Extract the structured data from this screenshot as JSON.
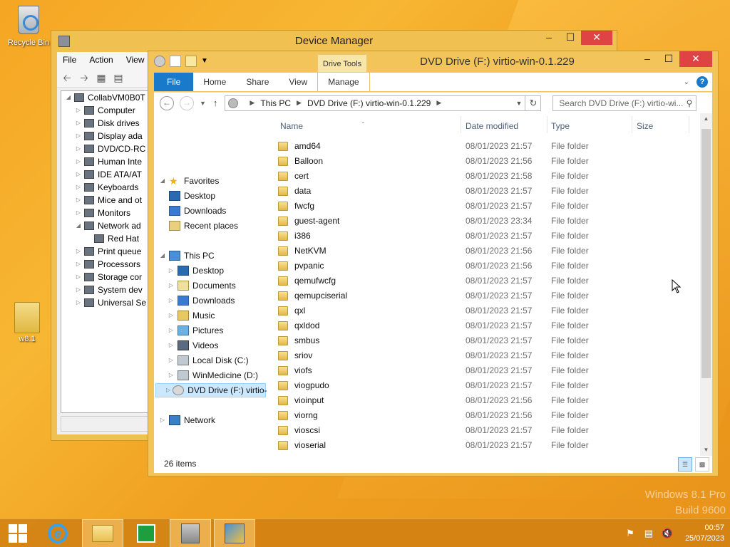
{
  "desktop": {
    "icons": [
      {
        "label": "Recycle Bin",
        "icon": "recycle-bin-icon"
      },
      {
        "label": "w8.1",
        "icon": "folder-icon"
      }
    ],
    "watermark": {
      "line1": "Windows 8.1 Pro",
      "line2": "Build 9600"
    }
  },
  "device_manager": {
    "title": "Device Manager",
    "menu": [
      "File",
      "Action",
      "View"
    ],
    "tree": [
      {
        "label": "CollabVM0B0T",
        "level": 0,
        "expanded": true
      },
      {
        "label": "Computer",
        "level": 1
      },
      {
        "label": "Disk drives",
        "level": 1
      },
      {
        "label": "Display ada",
        "level": 1
      },
      {
        "label": "DVD/CD-RC",
        "level": 1
      },
      {
        "label": "Human Inte",
        "level": 1
      },
      {
        "label": "IDE ATA/AT",
        "level": 1
      },
      {
        "label": "Keyboards",
        "level": 1
      },
      {
        "label": "Mice and ot",
        "level": 1
      },
      {
        "label": "Monitors",
        "level": 1
      },
      {
        "label": "Network ad",
        "level": 1,
        "expanded": true
      },
      {
        "label": "Red Hat",
        "level": 2
      },
      {
        "label": "Print queue",
        "level": 1
      },
      {
        "label": "Processors",
        "level": 1
      },
      {
        "label": "Storage cor",
        "level": 1
      },
      {
        "label": "System dev",
        "level": 1
      },
      {
        "label": "Universal Se",
        "level": 1
      }
    ]
  },
  "explorer": {
    "title": "DVD Drive (F:) virtio-win-0.1.229",
    "context_tab": "Drive Tools",
    "tabs": [
      "File",
      "Home",
      "Share",
      "View",
      "Manage"
    ],
    "address": {
      "segments": [
        "This PC",
        "DVD Drive (F:) virtio-win-0.1.229"
      ]
    },
    "search_placeholder": "Search DVD Drive (F:) virtio-wi...",
    "nav": {
      "favorites_label": "Favorites",
      "favorites": [
        "Desktop",
        "Downloads",
        "Recent places"
      ],
      "thispc_label": "This PC",
      "thispc": [
        "Desktop",
        "Documents",
        "Downloads",
        "Music",
        "Pictures",
        "Videos",
        "Local Disk (C:)",
        "WinMedicine (D:)",
        "DVD Drive (F:) virtio-"
      ],
      "network_label": "Network"
    },
    "columns": {
      "name": "Name",
      "date": "Date modified",
      "type": "Type",
      "size": "Size"
    },
    "files": [
      {
        "name": "amd64",
        "date": "08/01/2023 21:57",
        "type": "File folder"
      },
      {
        "name": "Balloon",
        "date": "08/01/2023 21:56",
        "type": "File folder"
      },
      {
        "name": "cert",
        "date": "08/01/2023 21:58",
        "type": "File folder"
      },
      {
        "name": "data",
        "date": "08/01/2023 21:57",
        "type": "File folder"
      },
      {
        "name": "fwcfg",
        "date": "08/01/2023 21:57",
        "type": "File folder"
      },
      {
        "name": "guest-agent",
        "date": "08/01/2023 23:34",
        "type": "File folder"
      },
      {
        "name": "i386",
        "date": "08/01/2023 21:57",
        "type": "File folder"
      },
      {
        "name": "NetKVM",
        "date": "08/01/2023 21:56",
        "type": "File folder"
      },
      {
        "name": "pvpanic",
        "date": "08/01/2023 21:56",
        "type": "File folder"
      },
      {
        "name": "qemufwcfg",
        "date": "08/01/2023 21:57",
        "type": "File folder"
      },
      {
        "name": "qemupciserial",
        "date": "08/01/2023 21:57",
        "type": "File folder"
      },
      {
        "name": "qxl",
        "date": "08/01/2023 21:57",
        "type": "File folder"
      },
      {
        "name": "qxldod",
        "date": "08/01/2023 21:57",
        "type": "File folder"
      },
      {
        "name": "smbus",
        "date": "08/01/2023 21:57",
        "type": "File folder"
      },
      {
        "name": "sriov",
        "date": "08/01/2023 21:57",
        "type": "File folder"
      },
      {
        "name": "viofs",
        "date": "08/01/2023 21:57",
        "type": "File folder"
      },
      {
        "name": "viogpudo",
        "date": "08/01/2023 21:57",
        "type": "File folder"
      },
      {
        "name": "vioinput",
        "date": "08/01/2023 21:56",
        "type": "File folder"
      },
      {
        "name": "viorng",
        "date": "08/01/2023 21:56",
        "type": "File folder"
      },
      {
        "name": "vioscsi",
        "date": "08/01/2023 21:57",
        "type": "File folder"
      },
      {
        "name": "vioserial",
        "date": "08/01/2023 21:57",
        "type": "File folder"
      }
    ],
    "status": "26 items"
  },
  "taskbar": {
    "items": [
      "start-icon",
      "internet-explorer-icon",
      "file-explorer-icon",
      "store-icon",
      "device-manager-icon",
      "setup-icon"
    ],
    "clock_time": "00:57",
    "clock_date": "25/07/2023"
  }
}
